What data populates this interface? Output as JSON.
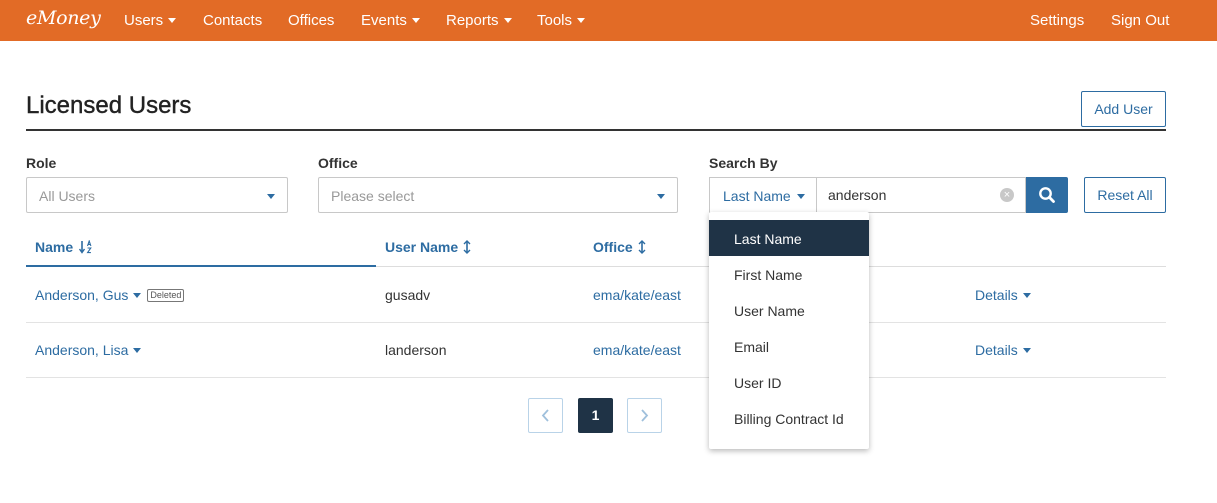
{
  "nav": {
    "brand": "eMoney",
    "items": [
      "Users",
      "Contacts",
      "Offices",
      "Events",
      "Reports",
      "Tools"
    ],
    "right_items": [
      "Settings",
      "Sign Out"
    ]
  },
  "header": {
    "title": "Licensed Users",
    "add_user_label": "Add User"
  },
  "filters": {
    "role_label": "Role",
    "role_value": "All Users",
    "office_label": "Office",
    "office_placeholder": "Please select",
    "search_by_label": "Search By",
    "search_by_value": "Last Name",
    "search_value": "anderson",
    "reset_label": "Reset All"
  },
  "search_by_options": [
    "Last Name",
    "First Name",
    "User Name",
    "Email",
    "User ID",
    "Billing Contract Id"
  ],
  "table": {
    "columns": [
      "Name",
      "User Name",
      "Office"
    ],
    "rows": [
      {
        "name": "Anderson, Gus",
        "badge": "Deleted",
        "username": "gusadv",
        "office": "ema/kate/east",
        "action": "Details"
      },
      {
        "name": "Anderson, Lisa",
        "badge": "",
        "username": "landerson",
        "office": "ema/kate/east",
        "action": "Details"
      }
    ]
  },
  "pagination": {
    "current_page": "1"
  },
  "colors": {
    "navbar": "#e26b26",
    "primary": "#2d6ca2",
    "dark": "#1f3346"
  }
}
